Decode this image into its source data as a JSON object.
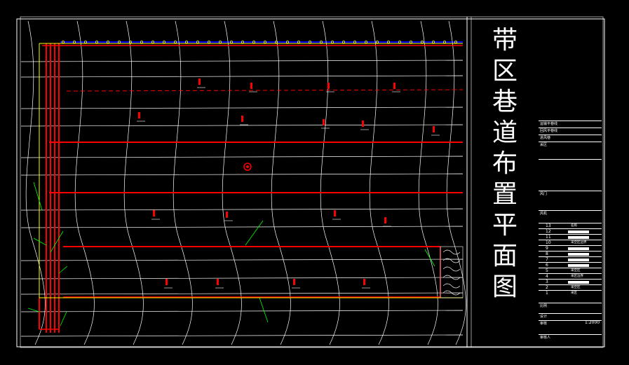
{
  "title": {
    "chars": [
      "带",
      "区",
      "巷",
      "道",
      "布",
      "置",
      "平",
      "面",
      "图"
    ]
  },
  "legend": {
    "top_rows": [
      "运输平巷线",
      "回风平巷线",
      "进风巷",
      "采区",
      "",
      "",
      "",
      "风门",
      "",
      "",
      "",
      "风机",
      "",
      ""
    ],
    "num_rows": [
      "13",
      "12",
      "11",
      "10",
      "9",
      "8",
      "7",
      "6",
      "5",
      "4",
      "3",
      "2",
      "1"
    ],
    "num_descs": [
      "名称",
      "",
      "",
      "采空区边界",
      "",
      "",
      "",
      "",
      "采空区",
      "采区边界",
      "",
      "采空区",
      "采区"
    ],
    "bottom_labels": [
      "比例",
      "设计",
      "审核",
      "",
      "审核人"
    ],
    "scale": "1:2000"
  },
  "colors": {
    "background": "#000000",
    "line": "#ffffff",
    "roadway": "#ff0000",
    "marker": "#ffff00",
    "annotation": "#00ff00",
    "top_edge": "#0000ff"
  },
  "icons": [
    "mine-symbol-icon",
    "ventilation-door-icon",
    "goaf-hatch-icon"
  ]
}
